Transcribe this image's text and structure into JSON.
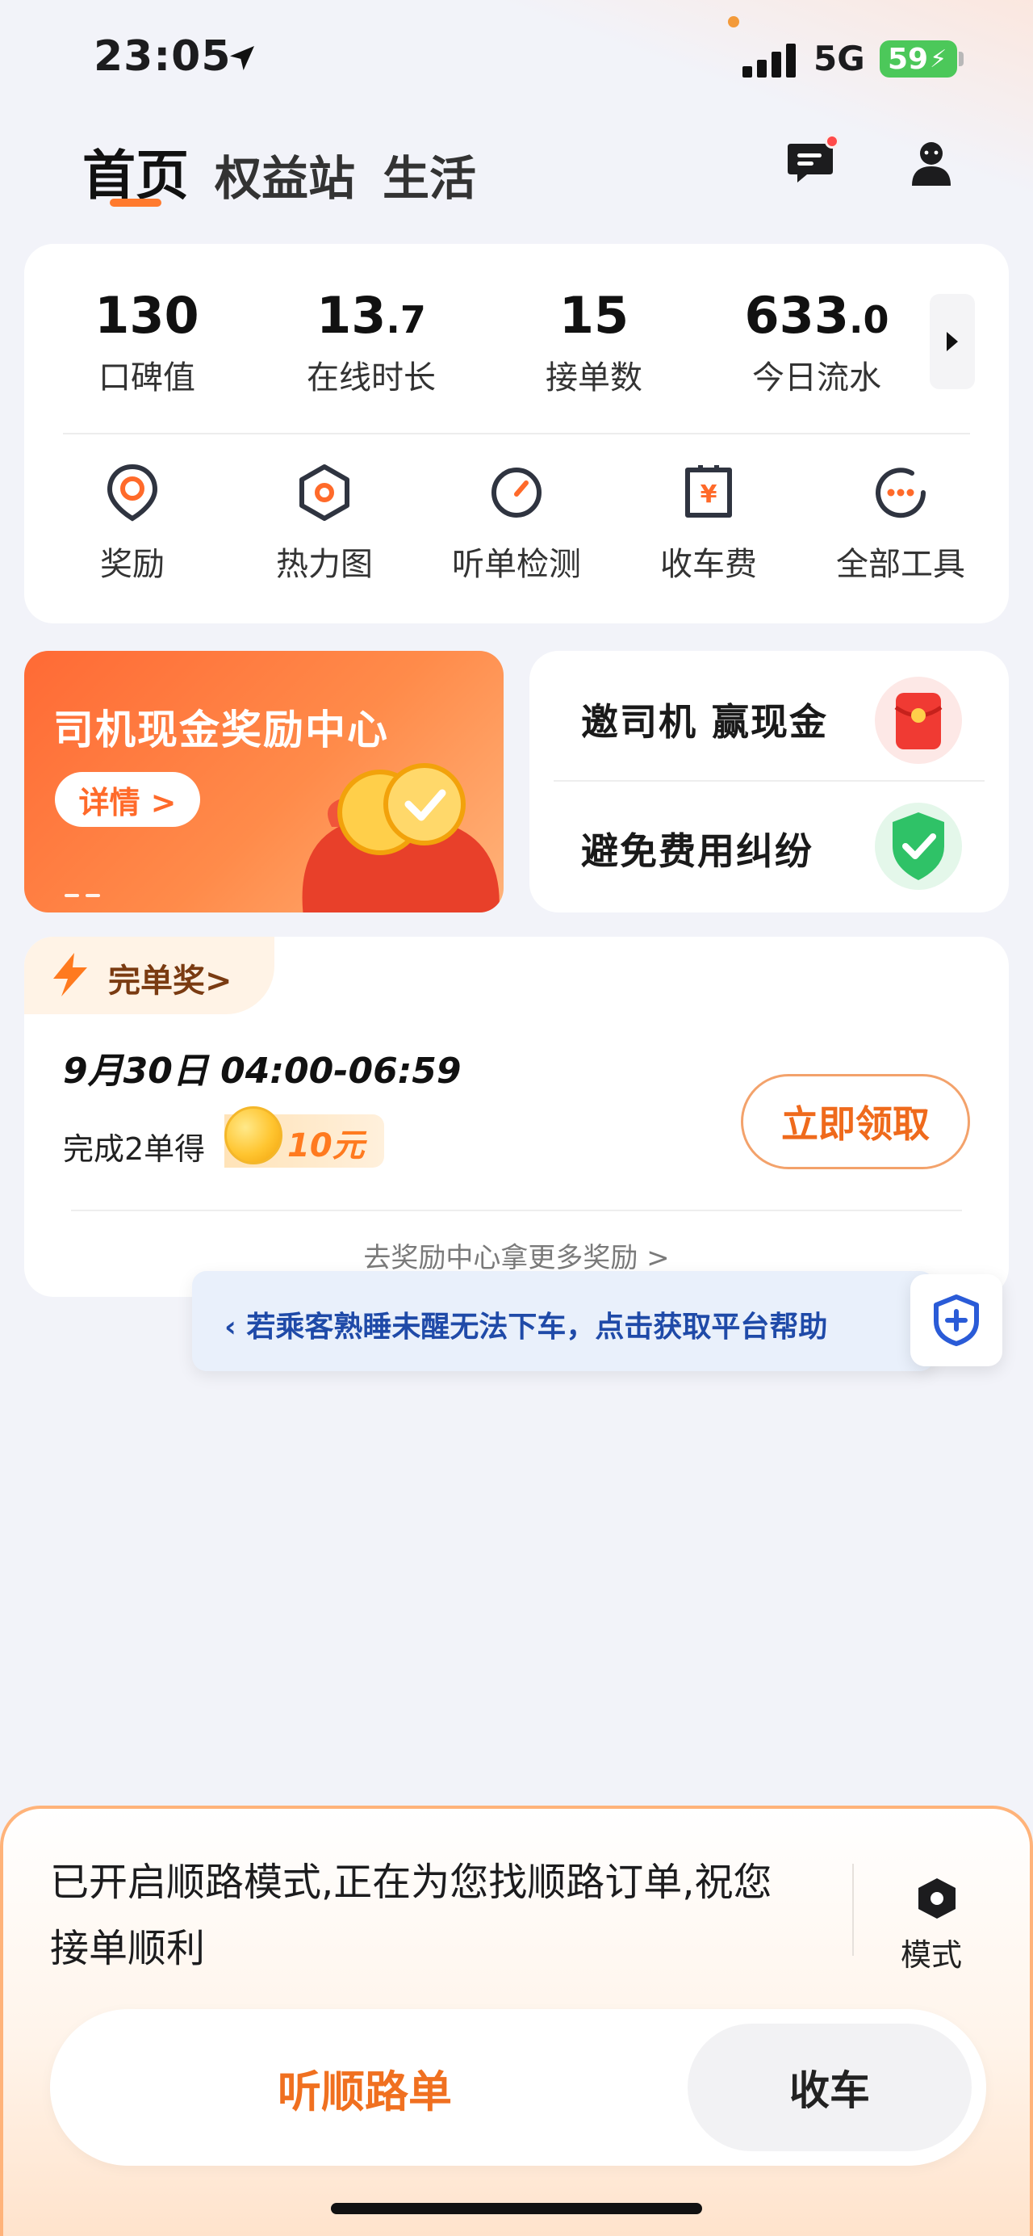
{
  "status_bar": {
    "time": "23:05",
    "network": "5G",
    "battery": "59"
  },
  "header": {
    "tabs": [
      {
        "label": "首页",
        "active": true
      },
      {
        "label": "权益站",
        "active": false
      },
      {
        "label": "生活",
        "active": false
      }
    ]
  },
  "stats": [
    {
      "value": "130",
      "decimal": "",
      "label": "口碑值"
    },
    {
      "value": "13",
      "decimal": ".7",
      "label": "在线时长"
    },
    {
      "value": "15",
      "decimal": "",
      "label": "接单数"
    },
    {
      "value": "633",
      "decimal": ".0",
      "label": "今日流水"
    }
  ],
  "tools": [
    {
      "label": "奖励",
      "icon": "target-pin-icon"
    },
    {
      "label": "热力图",
      "icon": "hexagon-heatmap-icon"
    },
    {
      "label": "听单检测",
      "icon": "gauge-icon"
    },
    {
      "label": "收车费",
      "icon": "yuan-receipt-icon"
    },
    {
      "label": "全部工具",
      "icon": "more-dots-icon"
    }
  ],
  "banner": {
    "title": "司机现金奖励中心",
    "button": "详情 >"
  },
  "promos": [
    {
      "label": "邀司机 赢现金",
      "icon": "red-envelope-icon"
    },
    {
      "label": "避免费用纠纷",
      "icon": "green-shield-icon"
    }
  ],
  "reward": {
    "tab_label": "完单奖>",
    "time_range": "9月30日 04:00-06:59",
    "desc": "完成2单得",
    "amount": "10元",
    "claim_button": "立即领取",
    "more_link": "去奖励中心拿更多奖励 >"
  },
  "tip": {
    "text": "若乘客熟睡未醒无法下车，点击获取平台帮助"
  },
  "bottom_sheet": {
    "message": "已开启顺路模式,正在为您找顺路订单,祝您接单顺利",
    "mode_label": "模式",
    "listen_button": "听顺路单",
    "stop_button": "收车"
  },
  "colors": {
    "accent": "#ff7a2e",
    "tip_text": "#1f4aa8",
    "battery": "#4cc85a"
  }
}
